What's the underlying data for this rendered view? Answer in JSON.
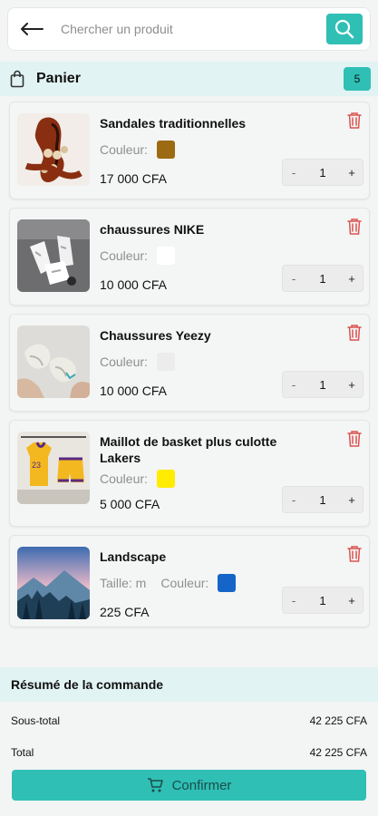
{
  "search": {
    "placeholder": "Chercher un produit"
  },
  "cart": {
    "title": "Panier",
    "count": "5"
  },
  "items": [
    {
      "name": "Sandales traditionnelles",
      "color_label": "Couleur:",
      "color": "#9b6a12",
      "qty": "1",
      "price": "17 000 CFA"
    },
    {
      "name": "chaussures NIKE",
      "color_label": "Couleur:",
      "color": "#ffffff",
      "qty": "1",
      "price": "10 000 CFA"
    },
    {
      "name": "Chaussures Yeezy",
      "color_label": "Couleur:",
      "color": "#ececec",
      "qty": "1",
      "price": "10 000 CFA"
    },
    {
      "name": "Maillot de basket plus culotte Lakers",
      "color_label": "Couleur:",
      "color": "#ffec00",
      "qty": "1",
      "price": "5 000 CFA"
    },
    {
      "name": "Landscape",
      "size_label": "Taille: m",
      "color_label": "Couleur:",
      "color": "#1565c8",
      "qty": "1",
      "price": "225 CFA"
    }
  ],
  "stepper": {
    "minus": "-",
    "plus": "+"
  },
  "summary": {
    "title": "Résumé de la commande",
    "subtotal_label": "Sous-total",
    "subtotal_value": "42 225 CFA",
    "total_label": "Total",
    "total_value": "42 225 CFA"
  },
  "confirm_label": "Confirmer",
  "colors": {
    "accent": "#2fbfb5",
    "header_bg": "#e1f3f2",
    "trash": "#d9534f"
  },
  "icons": {
    "back": "arrow-left-icon",
    "search": "search-icon",
    "bag": "shopping-bag-icon",
    "trash": "trash-icon",
    "cart": "cart-icon"
  }
}
